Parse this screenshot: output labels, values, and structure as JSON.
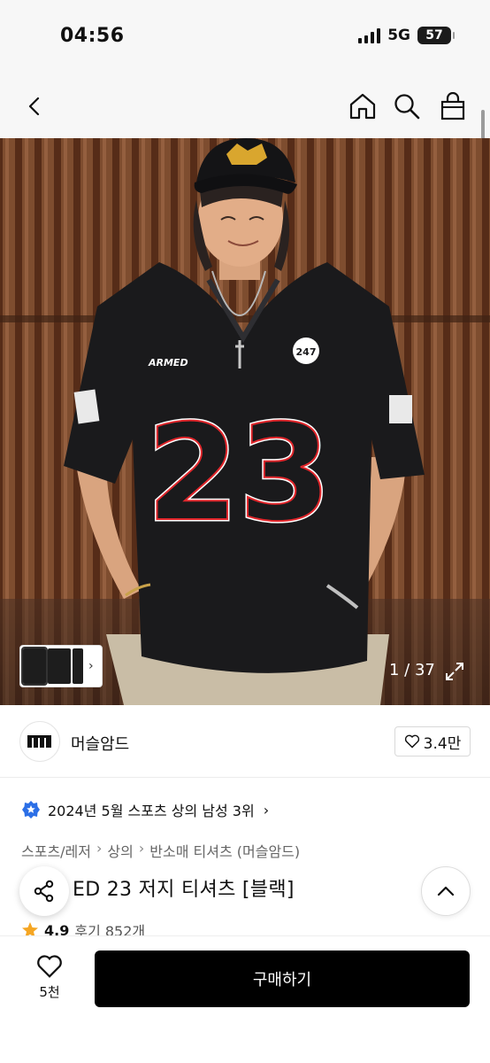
{
  "status_bar": {
    "time": "04:56",
    "network": "5G",
    "battery": "57"
  },
  "gallery": {
    "counter": "1 / 37"
  },
  "brand": {
    "name": "머슬암드",
    "likes": "3.4만"
  },
  "ranking": {
    "text": "2024년 5월 스포츠 상의 남성 3위"
  },
  "breadcrumb": [
    "스포츠/레저",
    "상의",
    "반소매 티셔츠 (머슬암드)"
  ],
  "product": {
    "title": "ED 23 저지 티셔츠 [블랙]",
    "rating": "4.9",
    "reviews": "후기 852개"
  },
  "bottom_bar": {
    "wish_count": "5천",
    "buy_label": "구매하기"
  },
  "photo": {
    "jersey_number": "23",
    "chest_text": "ARMED",
    "badge_text": "247"
  },
  "colors": {
    "accent": "#000000",
    "rank_badge": "#2c6fe6",
    "star": "#f5a623"
  }
}
